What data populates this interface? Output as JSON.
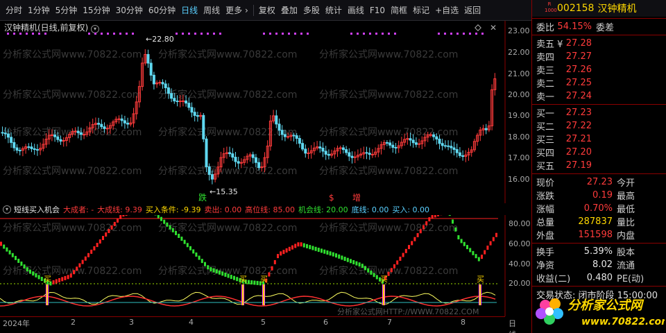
{
  "toolbar": {
    "items": [
      "分时",
      "1分钟",
      "5分钟",
      "15分钟",
      "30分钟",
      "60分钟",
      "日线",
      "周线",
      "更多 ›",
      "复权",
      "叠加",
      "多股",
      "统计",
      "画线",
      "F10",
      "简框",
      "标记",
      "+自选",
      "返回"
    ]
  },
  "chart": {
    "title": "汉钟精机(日线,前复权)",
    "price_ticks": [
      "23.00",
      "22.00",
      "21.00",
      "20.00",
      "19.00",
      "18.00",
      "17.00",
      "16.00"
    ],
    "high_label": "22.80",
    "low_label": "15.35",
    "marker_die": "跌",
    "marker_s": "$",
    "marker_zeng": "增",
    "watermark": "分析家公式网www.70822.com"
  },
  "indicator": {
    "name": "短线买入机会",
    "big_player_label": "大成者: -",
    "big_line_label": "大成线: 9.39",
    "buy_condition_label": "买入条件: -9.39",
    "sell_label": "卖出: 0.00",
    "high_line_label": "高位线: 85.00",
    "chance_line_label": "机会线: 20.00",
    "bottom_line_label": "底线: 0.00",
    "buy_in_label": "买入: 0.00",
    "ticks": [
      "80.00",
      "60.00",
      "40.00",
      "20.00"
    ],
    "buy_marker": "买",
    "footer_watermark": "分析家公式网HTTP://WWW.70822.COM"
  },
  "xaxis": {
    "labels": [
      "2024年",
      "2",
      "3",
      "4",
      "5",
      "6",
      "7",
      "8"
    ],
    "period": "日线"
  },
  "quote": {
    "code": "002158",
    "name": "汉钟精机",
    "badge_top": "R",
    "badge_bottom": "1000",
    "weibi_label": "委比",
    "weibi_value": "54.15%",
    "weicha_label": "委差",
    "asks": [
      {
        "label": "卖五 ¥",
        "price": "27.28"
      },
      {
        "label": "卖四",
        "price": "27.27"
      },
      {
        "label": "卖三",
        "price": "27.26"
      },
      {
        "label": "卖二",
        "price": "27.25"
      },
      {
        "label": "卖一",
        "price": "27.24"
      }
    ],
    "bids": [
      {
        "label": "买一",
        "price": "27.23"
      },
      {
        "label": "买二",
        "price": "27.22"
      },
      {
        "label": "买三",
        "price": "27.21"
      },
      {
        "label": "买四",
        "price": "27.20"
      },
      {
        "label": "买五",
        "price": "27.19"
      }
    ],
    "stats": [
      {
        "l1": "现价",
        "v1": "27.23",
        "c1": "red",
        "l2": "今开"
      },
      {
        "l1": "涨跌",
        "v1": "0.19",
        "c1": "red",
        "l2": "最高"
      },
      {
        "l1": "涨幅",
        "v1": "0.70%",
        "c1": "red",
        "l2": "最低"
      },
      {
        "l1": "总量",
        "v1": "287837",
        "c1": "yel",
        "l2": "量比"
      },
      {
        "l1": "外盘",
        "v1": "151598",
        "c1": "red",
        "l2": "内盘"
      }
    ],
    "stats2": [
      {
        "l1": "换手",
        "v1": "5.39%",
        "l2": "股本"
      },
      {
        "l1": "净资",
        "v1": "8.02",
        "l2": "流通"
      },
      {
        "l1": "收益(二)",
        "v1": "0.480",
        "l2": "PE(动)"
      }
    ],
    "status": "交易状态: 闭市阶段 15:00:00"
  },
  "logo": {
    "text": "分析家公式网",
    "url": "www.70822.com"
  },
  "colors": {
    "up": "#ff3b3b",
    "down": "#5fd8f0",
    "accent": "#5ad0ff",
    "buy": "#ffd800",
    "ind_up": "#ff2020",
    "ind_down": "#30e030"
  }
}
